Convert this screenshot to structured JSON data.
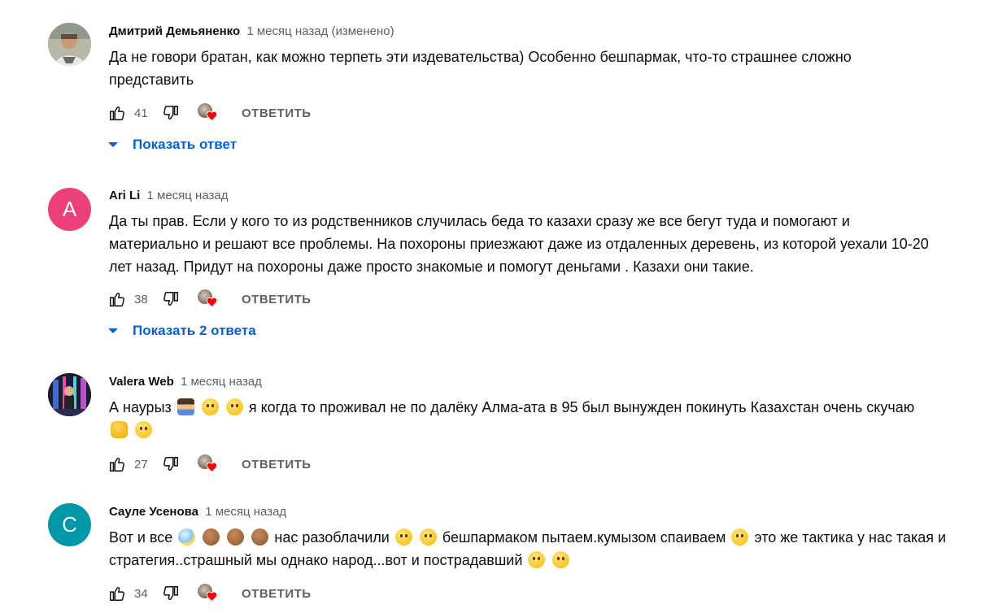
{
  "comments": [
    {
      "author": "Дмитрий Демьяненко",
      "time": "1 месяц назад (изменено)",
      "avatar_icon": "photo-avatar",
      "text_line1": "Да не говори братан, как можно терпеть эти издевательства) Особенно бешпармак, что-то страшнее сложно",
      "text_line2": "представить",
      "likes": "41",
      "reply_label": "ОТВЕТИТЬ",
      "show_replies": "Показать ответ"
    },
    {
      "author": "Ari Li",
      "time": "1 месяц назад",
      "avatar_letter": "A",
      "avatar_color": "#ec407a",
      "text_line1": "Да ты прав. Если у кого то из родственников случилась беда то казахи сразу же все бегут туда и помогают и",
      "text_line2": "материально и решают все проблемы. На похороны приезжают даже из отдаленных деревень, из которой уехали 10-20",
      "text_line3": "лет назад. Придут на похороны даже просто знакомые и помогут деньгами . Казахи они такие.",
      "likes": "38",
      "reply_label": "ОТВЕТИТЬ",
      "show_replies": "Показать 2 ответа"
    },
    {
      "author": "Valera Web",
      "time": "1 месяц назад",
      "avatar_icon": "photo-avatar",
      "text_start": "А наурыз",
      "text_end": "я когда то проживал не по далёку Алма-ата в 95 был вынужден покинуть Казахстан очень скучаю",
      "likes": "27",
      "reply_label": "ОТВЕТИТЬ"
    },
    {
      "author": "Сауле Усенова",
      "time": "1 месяц назад",
      "avatar_letter": "С",
      "avatar_color": "#0097a7",
      "text_a": "Вот и все",
      "text_b": "нас разоблачили",
      "text_c": "бешпармаком пытаем.кумызом спаиваем",
      "text_d": "это же тактика у нас такая и",
      "text_line2": "стратегия..страшный мы однако народ...вот и пострадавший",
      "likes": "34",
      "reply_label": "ОТВЕТИТЬ"
    }
  ],
  "colors": {
    "link": "#065fd4",
    "secondary_text": "#606060",
    "heart": "#ff0000"
  }
}
